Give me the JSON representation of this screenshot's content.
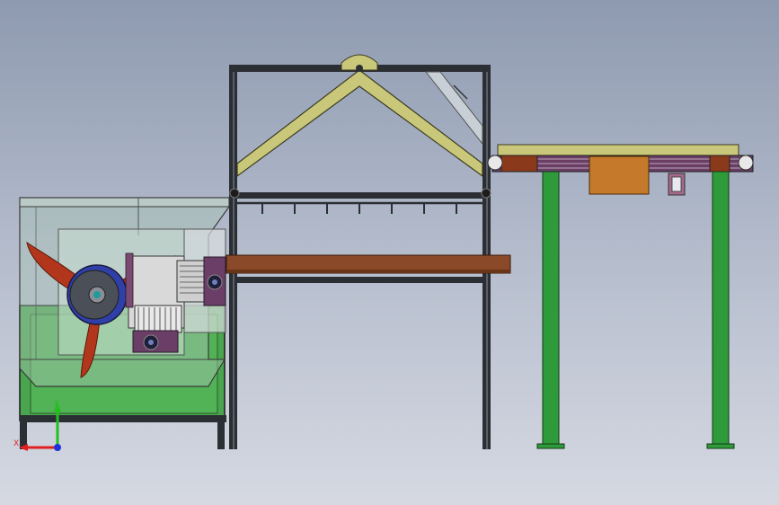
{
  "viewport": {
    "background_top": "#8e9ab0",
    "background_bottom": "#d6d9e2"
  },
  "palette": {
    "frame_steel": "#2b2e33",
    "hood_yellow": "#c9c77a",
    "table_brown": "#8a4a2a",
    "tank_green": "#4aa64e",
    "leg_green": "#2e9a3a",
    "fan_red": "#b2361c",
    "motor_purple": "#6a3e66",
    "box_orange": "#c47a2a",
    "glass_tint": "#b8d4c2"
  },
  "triad": {
    "x_label": "X",
    "y_label": "Y",
    "x_color": "#e02020",
    "y_color": "#20c020",
    "z_color": "#2030e0"
  },
  "parts": [
    "glass-enclosure",
    "green-tank",
    "fan-rotor",
    "drive-motor",
    "steel-frame",
    "triangular-hood",
    "hanging-hooks",
    "wooden-shelf",
    "conveyor-table",
    "control-box",
    "support-legs"
  ]
}
